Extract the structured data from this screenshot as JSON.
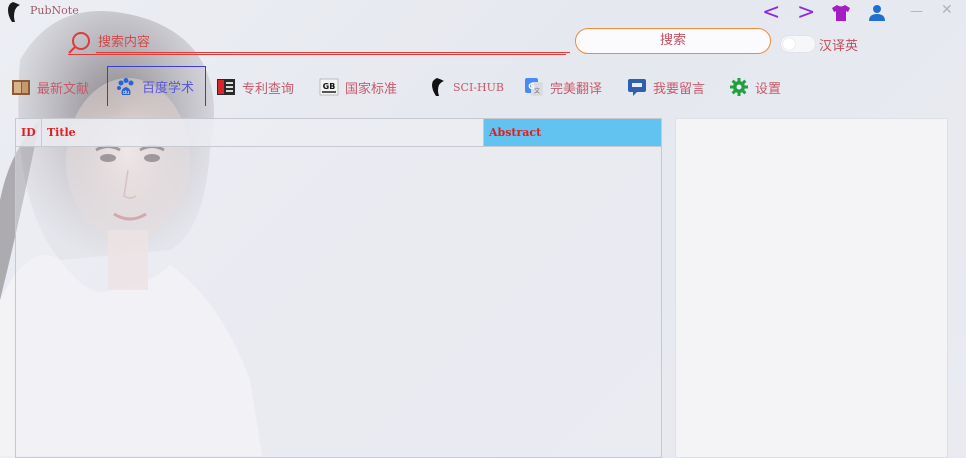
{
  "app": {
    "title": "PubNote"
  },
  "search": {
    "placeholder": "搜索内容",
    "button_label": "搜索",
    "translate_label": "汉译英"
  },
  "nav": {
    "items": [
      {
        "label": "最新文献",
        "icon": "latest-papers-icon"
      },
      {
        "label": "百度学术",
        "icon": "baidu-paw-icon",
        "active": true
      },
      {
        "label": "专利查询",
        "icon": "patent-icon"
      },
      {
        "label": "国家标准",
        "icon": "gb-standard-icon"
      },
      {
        "label": "SCI-HUB",
        "icon": "crow-icon"
      },
      {
        "label": "完美翻译",
        "icon": "google-translate-icon"
      },
      {
        "label": "我要留言",
        "icon": "message-icon"
      },
      {
        "label": "设置",
        "icon": "gear-icon"
      }
    ]
  },
  "table": {
    "columns": [
      "ID",
      "Title",
      "Abstract"
    ],
    "rows": []
  },
  "colors": {
    "accent_red": "#e03a3a",
    "nav_text": "#c65a6a",
    "abstract_header": "#62c2f0",
    "window_icons": "#8a2be2"
  }
}
